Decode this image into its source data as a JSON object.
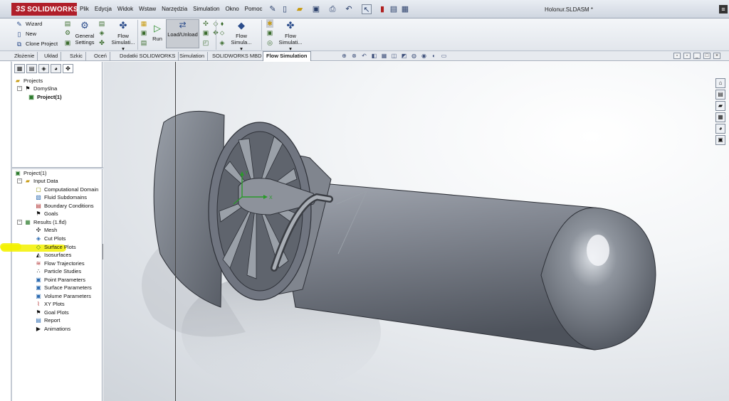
{
  "app": {
    "logo_prefix": "3S",
    "logo_text": "SOLIDWORKS",
    "doc_title": "Holonur.SLDASM *"
  },
  "menu": [
    "Plik",
    "Edycja",
    "Widok",
    "Wstaw",
    "Narzędzia",
    "Simulation",
    "Okno",
    "Pomoc"
  ],
  "cmd": {
    "wizard": "Wizard",
    "new": "New",
    "clone": "Clone Project",
    "general_settings_1": "General",
    "general_settings_2": "Settings",
    "flow_sim_1": "Flow",
    "flow_sim_2": "Simulati...",
    "run": "Run",
    "load_unload": "Load/Unload",
    "flow_simula_1": "Flow",
    "flow_simula_2": "Simula...",
    "flow_simulati_1": "Flow",
    "flow_simulati_2": "Simulati..."
  },
  "tabs": [
    "Złożenie",
    "Układ",
    "Szkic",
    "Oceń",
    "Dodatki SOLIDWORKS",
    "Simulation",
    "SOLIDWORKS MBD",
    "Flow Simulation"
  ],
  "tree_top": {
    "projects": "Projects",
    "default": "Domyślna",
    "project": "Project(1)"
  },
  "tree_bottom": {
    "root": "Project(1)",
    "input_data": "Input Data",
    "input_items": [
      "Computational Domain",
      "Fluid Subdomains",
      "Boundary Conditions",
      "Goals"
    ],
    "results": "Results (1.fld)",
    "result_items": [
      "Mesh",
      "Cut Plots",
      "Surface Plots",
      "Isosurfaces",
      "Flow Trajectories",
      "Particle Studies",
      "Point Parameters",
      "Surface Parameters",
      "Volume Parameters",
      "XY Plots",
      "Goal Plots",
      "Report",
      "Animations"
    ]
  },
  "triad": {
    "x": "X",
    "y": "Y"
  },
  "colors": {
    "logo_bg": "#b01f2a",
    "highlight": "#f3f100",
    "model_body": "#7a7f88"
  }
}
